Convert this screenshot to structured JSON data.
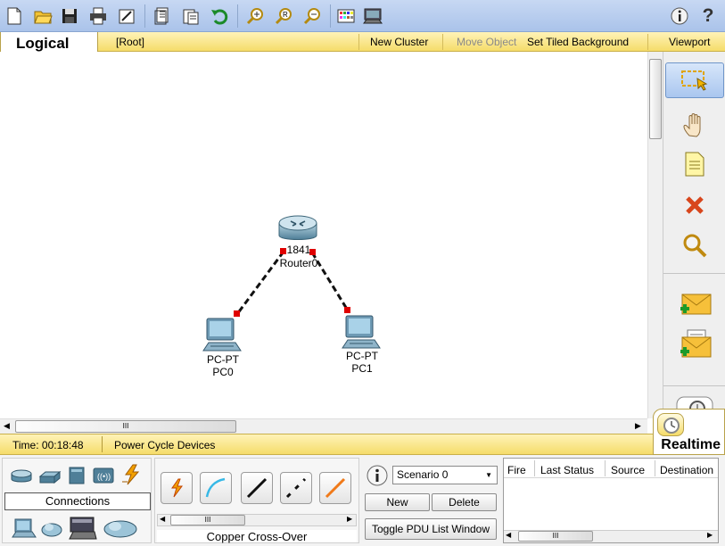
{
  "toolbar": {
    "icons": [
      "new-file-icon",
      "open-folder-icon",
      "save-icon",
      "print-icon",
      "activity-wizard-icon",
      "copy-icon",
      "paste-icon",
      "undo-icon",
      "zoom-in-icon",
      "zoom-reset-icon",
      "zoom-out-icon",
      "palette-icon",
      "custom-device-icon",
      "info-icon",
      "help-icon"
    ],
    "help_label": "?"
  },
  "logical_bar": {
    "tab_label": "Logical",
    "root_label": "[Root]",
    "new_cluster": "New Cluster",
    "move_object": "Move Object",
    "set_tiled_background": "Set Tiled Background",
    "viewport": "Viewport"
  },
  "workspace": {
    "router": {
      "model": "1841",
      "name": "Router0"
    },
    "pc0": {
      "model": "PC-PT",
      "name": "PC0"
    },
    "pc1": {
      "model": "PC-PT",
      "name": "PC1"
    },
    "scroll_grip": "III"
  },
  "right_palette": {
    "icons": [
      "select-icon",
      "move-hand-icon",
      "note-icon",
      "delete-icon",
      "inspect-icon",
      "add-simple-pdu-icon",
      "add-complex-pdu-icon",
      "simulation-stopwatch-icon"
    ]
  },
  "status_bar": {
    "time": "Time: 00:18:48",
    "power_cycle": "Power Cycle Devices",
    "mode": "Realtime"
  },
  "device_panel": {
    "category_label": "Connections",
    "connection_type_label": "Copper Cross-Over",
    "scroll_grip": "III"
  },
  "scenario": {
    "selected": "Scenario 0",
    "new_label": "New",
    "delete_label": "Delete",
    "toggle_label": "Toggle PDU List Window"
  },
  "pdu_table": {
    "columns": [
      "Fire",
      "Last Status",
      "Source",
      "Destination"
    ],
    "scroll_grip": "III"
  },
  "colors": {
    "yellow_bar": "#f5dc6a",
    "toolbar_blue": "#aac3ea",
    "link_red": "#e00000"
  }
}
